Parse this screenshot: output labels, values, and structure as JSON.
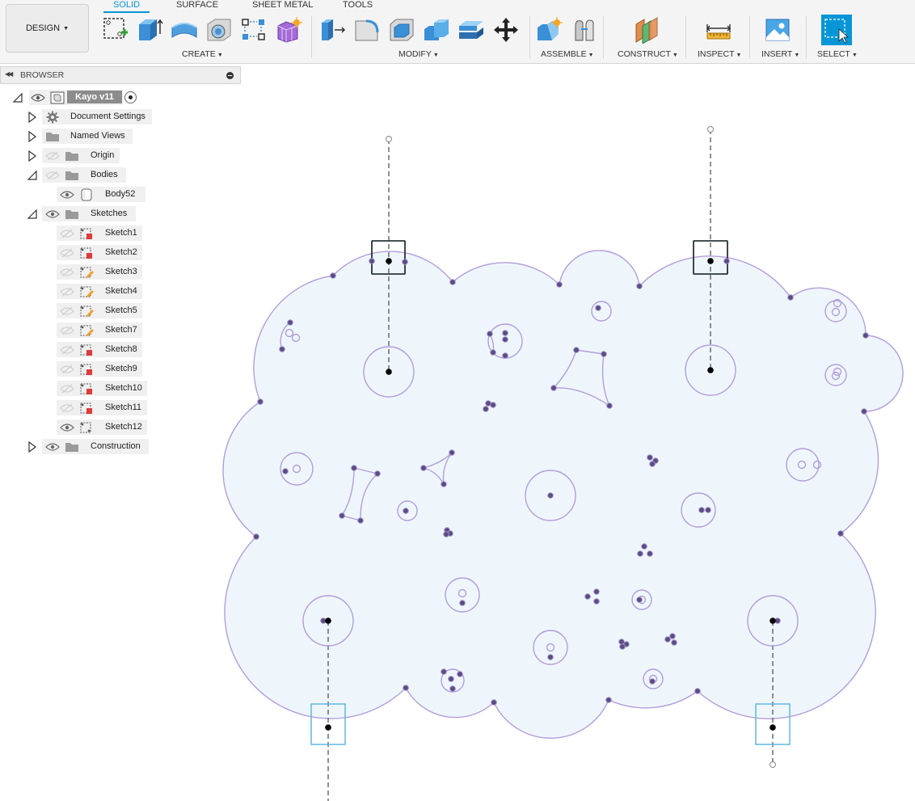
{
  "workspace": {
    "label": "DESIGN"
  },
  "tabs": [
    {
      "id": "solid",
      "label": "SOLID",
      "active": true
    },
    {
      "id": "surface",
      "label": "SURFACE",
      "active": false
    },
    {
      "id": "sheet_metal",
      "label": "SHEET METAL",
      "active": false
    },
    {
      "id": "tools",
      "label": "TOOLS",
      "active": false
    }
  ],
  "groups": {
    "create": "CREATE",
    "modify": "MODIFY",
    "assemble": "ASSEMBLE",
    "construct": "CONSTRUCT",
    "inspect": "INSPECT",
    "insert": "INSERT",
    "select": "SELECT"
  },
  "browser": {
    "title": "BROWSER",
    "root": {
      "label": "Kayo v11"
    },
    "items": [
      {
        "id": "document_settings",
        "label": "Document Settings",
        "icon": "gear-icon"
      },
      {
        "id": "named_views",
        "label": "Named Views",
        "icon": "folder-icon"
      },
      {
        "id": "origin",
        "label": "Origin",
        "icon": "folder-icon",
        "visible": false
      },
      {
        "id": "bodies",
        "label": "Bodies",
        "icon": "folder-icon",
        "visible": false
      },
      {
        "id": "body52",
        "label": "Body52",
        "icon": "body-icon",
        "visible": true
      },
      {
        "id": "sketches",
        "label": "Sketches",
        "icon": "folder-icon",
        "visible": true
      },
      {
        "id": "construction",
        "label": "Construction",
        "icon": "folder-icon",
        "visible": true
      }
    ],
    "sketches": [
      {
        "label": "Sketch1",
        "visible": false,
        "status": "error"
      },
      {
        "label": "Sketch2",
        "visible": false,
        "status": "error"
      },
      {
        "label": "Sketch3",
        "visible": false,
        "status": "edit"
      },
      {
        "label": "Sketch4",
        "visible": false,
        "status": "edit"
      },
      {
        "label": "Sketch5",
        "visible": false,
        "status": "edit"
      },
      {
        "label": "Sketch7",
        "visible": false,
        "status": "edit"
      },
      {
        "label": "Sketch8",
        "visible": false,
        "status": "error"
      },
      {
        "label": "Sketch9",
        "visible": false,
        "status": "error"
      },
      {
        "label": "Sketch10",
        "visible": false,
        "status": "error"
      },
      {
        "label": "Sketch11",
        "visible": false,
        "status": "error"
      },
      {
        "label": "Sketch12",
        "visible": true,
        "status": "normal"
      }
    ]
  },
  "colors": {
    "accent": "#0696d7",
    "sketch_profile": "#b39ddb",
    "sketch_fill": "#eef6fc",
    "sketch_point": "#5c4a86",
    "construction_box": "#5fb8e0"
  }
}
